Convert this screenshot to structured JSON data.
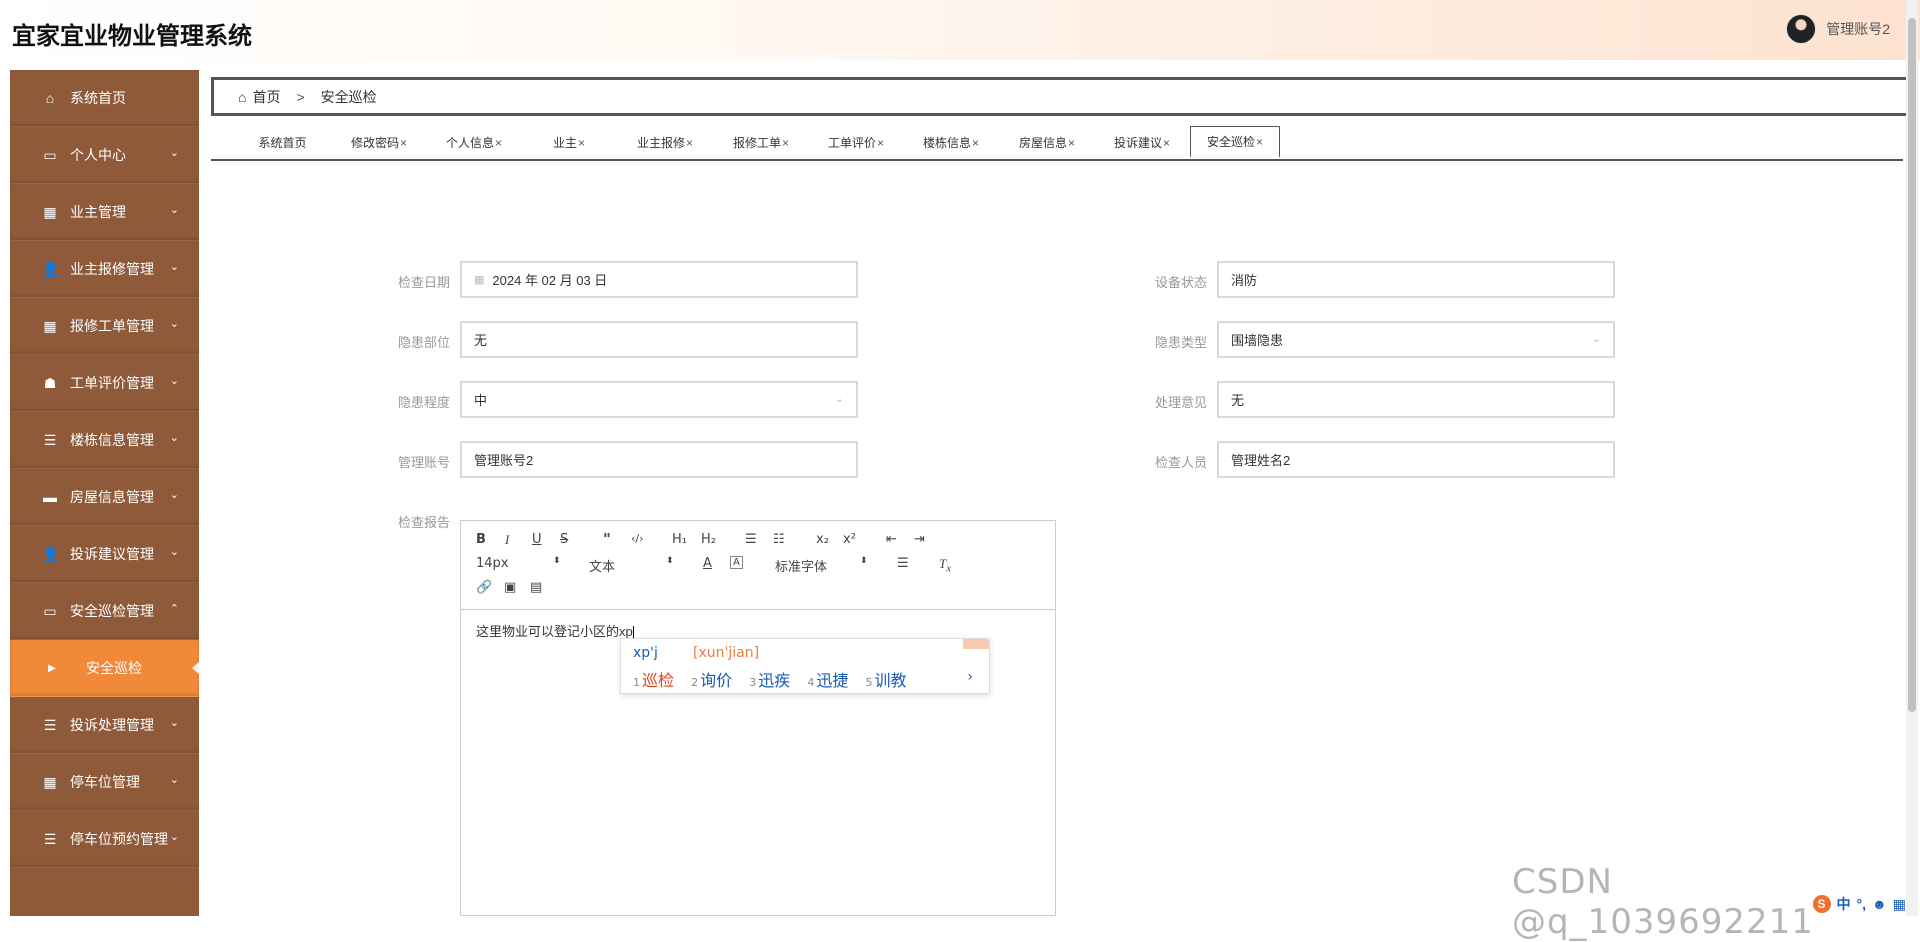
{
  "header": {
    "title": "宜家宜业物业管理系统",
    "username": "管理账号2"
  },
  "sidebar": {
    "items": [
      {
        "label": "系统首页",
        "icon": "⌂",
        "caret": ""
      },
      {
        "label": "个人中心",
        "icon": "▭",
        "caret": "⌄"
      },
      {
        "label": "业主管理",
        "icon": "▦",
        "caret": "⌄"
      },
      {
        "label": "业主报修管理",
        "icon": "👤",
        "caret": "⌄"
      },
      {
        "label": "报修工单管理",
        "icon": "▦",
        "caret": "⌄"
      },
      {
        "label": "工单评价管理",
        "icon": "☗",
        "caret": "⌄"
      },
      {
        "label": "楼栋信息管理",
        "icon": "☰",
        "caret": "⌄"
      },
      {
        "label": "房屋信息管理",
        "icon": "▬",
        "caret": "⌄"
      },
      {
        "label": "投诉建议管理",
        "icon": "👤",
        "caret": "⌄"
      },
      {
        "label": "安全巡检管理",
        "icon": "▭",
        "caret": "⌃"
      },
      {
        "label": "安全巡检",
        "icon": "▶",
        "caret": ""
      },
      {
        "label": "投诉处理管理",
        "icon": "☰",
        "caret": "⌄"
      },
      {
        "label": "停车位管理",
        "icon": "▦",
        "caret": "⌄"
      },
      {
        "label": "停车位预约管理",
        "icon": "☰",
        "caret": "⌄"
      }
    ]
  },
  "breadcrumb": {
    "home": "首页",
    "sep": ">",
    "current": "安全巡检"
  },
  "tabs": [
    {
      "label": "系统首页",
      "close": ""
    },
    {
      "label": "修改密码",
      "close": "×"
    },
    {
      "label": "个人信息",
      "close": "×"
    },
    {
      "label": "业主",
      "close": "×"
    },
    {
      "label": "业主报修",
      "close": "×"
    },
    {
      "label": "报修工单",
      "close": "×"
    },
    {
      "label": "工单评价",
      "close": "×"
    },
    {
      "label": "楼栋信息",
      "close": "×"
    },
    {
      "label": "房屋信息",
      "close": "×"
    },
    {
      "label": "投诉建议",
      "close": "×"
    },
    {
      "label": "安全巡检",
      "close": "×"
    }
  ],
  "form": {
    "check_date": {
      "label": "检查日期",
      "value": "2024 年 02 月 03 日"
    },
    "device_status": {
      "label": "设备状态",
      "value": "消防"
    },
    "hazard_location": {
      "label": "隐患部位",
      "value": "无"
    },
    "hazard_type": {
      "label": "隐患类型",
      "value": "围墙隐患"
    },
    "hazard_level": {
      "label": "隐患程度",
      "value": "中"
    },
    "handling_opinion": {
      "label": "处理意见",
      "value": "无"
    },
    "admin_account": {
      "label": "管理账号",
      "value": "管理账号2"
    },
    "inspector": {
      "label": "检查人员",
      "value": "管理姓名2"
    },
    "report": {
      "label": "检查报告",
      "content": "这里物业可以登记小区的xp"
    }
  },
  "editor_toolbar": {
    "font_size": "14px",
    "heading": "文本",
    "font_family": "标准字体"
  },
  "ime": {
    "composition": "xp'j",
    "pinyin": "[xun'jian]",
    "candidates": [
      {
        "n": "1",
        "text": "巡检"
      },
      {
        "n": "2",
        "text": "询价"
      },
      {
        "n": "3",
        "text": "迅疾"
      },
      {
        "n": "4",
        "text": "迅捷"
      },
      {
        "n": "5",
        "text": "训教"
      }
    ],
    "next": "›"
  },
  "watermark": "CSDN @q_1039692211",
  "ime_status": {
    "logo": "S",
    "mode": "中",
    "punct": "°,"
  }
}
